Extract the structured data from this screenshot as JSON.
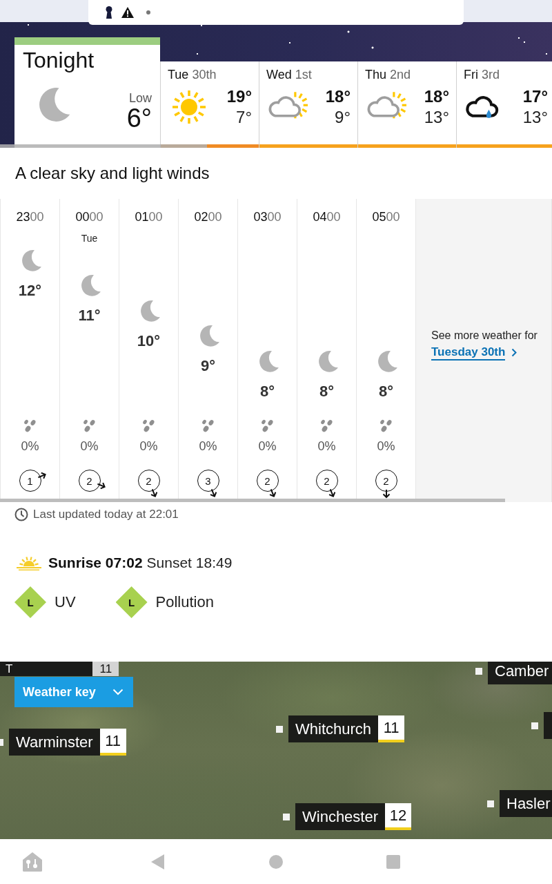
{
  "tonight": {
    "title": "Tonight",
    "low_label": "Low",
    "low": "6°"
  },
  "days": [
    {
      "weekday": "Tue",
      "date": "30th",
      "kind": "sun",
      "high": "19°",
      "low": "7°",
      "color": "#f08b24"
    },
    {
      "weekday": "Wed",
      "date": "1st",
      "kind": "partcloud",
      "high": "18°",
      "low": "9°",
      "color": "#f6a21e"
    },
    {
      "weekday": "Thu",
      "date": "2nd",
      "kind": "partcloud",
      "high": "18°",
      "low": "13°",
      "color": "#f6a21e"
    },
    {
      "weekday": "Fri",
      "date": "3rd",
      "kind": "rain",
      "high": "17°",
      "low": "13°",
      "color": "#f6a21e"
    }
  ],
  "summary": "A clear sky and light winds",
  "hours": [
    {
      "hour": "23",
      "minutes": "00",
      "temp": "12°",
      "rain_chance": "0%",
      "wind_speed": "1",
      "kind": "ene"
    },
    {
      "hour": "00",
      "minutes": "00",
      "day": "Tue",
      "temp": "11°",
      "rain_chance": "0%",
      "wind_speed": "2",
      "kind": "ese"
    },
    {
      "hour": "01",
      "minutes": "00",
      "temp": "10°",
      "rain_chance": "0%",
      "wind_speed": "2",
      "kind": "sse"
    },
    {
      "hour": "02",
      "minutes": "00",
      "temp": "9°",
      "rain_chance": "0%",
      "wind_speed": "3",
      "kind": "sse"
    },
    {
      "hour": "03",
      "minutes": "00",
      "temp": "8°",
      "rain_chance": "0%",
      "wind_speed": "2",
      "kind": "sse"
    },
    {
      "hour": "04",
      "minutes": "00",
      "temp": "8°",
      "rain_chance": "0%",
      "wind_speed": "2",
      "kind": "sse"
    },
    {
      "hour": "05",
      "minutes": "00",
      "temp": "8°",
      "rain_chance": "0%",
      "wind_speed": "2",
      "kind": "s"
    }
  ],
  "more_weather": {
    "text": "See more weather for",
    "link": "Tuesday 30th"
  },
  "last_updated": "Last updated today at 22:01",
  "sun_times": {
    "sunrise": "Sunrise 07:02",
    "sunset": "Sunset 18:49"
  },
  "indices": [
    {
      "rating": "L",
      "label": "UV",
      "color": "#a8d14f"
    },
    {
      "rating": "L",
      "label": "Pollution",
      "color": "#a8d14f"
    }
  ],
  "map": {
    "button": "Weather key",
    "places": [
      {
        "kind": "label",
        "name": "T",
        "temp": "11"
      },
      {
        "kind": "label",
        "name": "Camber"
      },
      {
        "kind": "label",
        "name": "Whitchurch",
        "temp": "11"
      },
      {
        "kind": "cropped"
      },
      {
        "kind": "label",
        "name": "Warminster",
        "temp": "11"
      },
      {
        "kind": "label",
        "name": "Winchester",
        "temp": "12"
      },
      {
        "kind": "label",
        "name": "Hasler"
      }
    ]
  }
}
